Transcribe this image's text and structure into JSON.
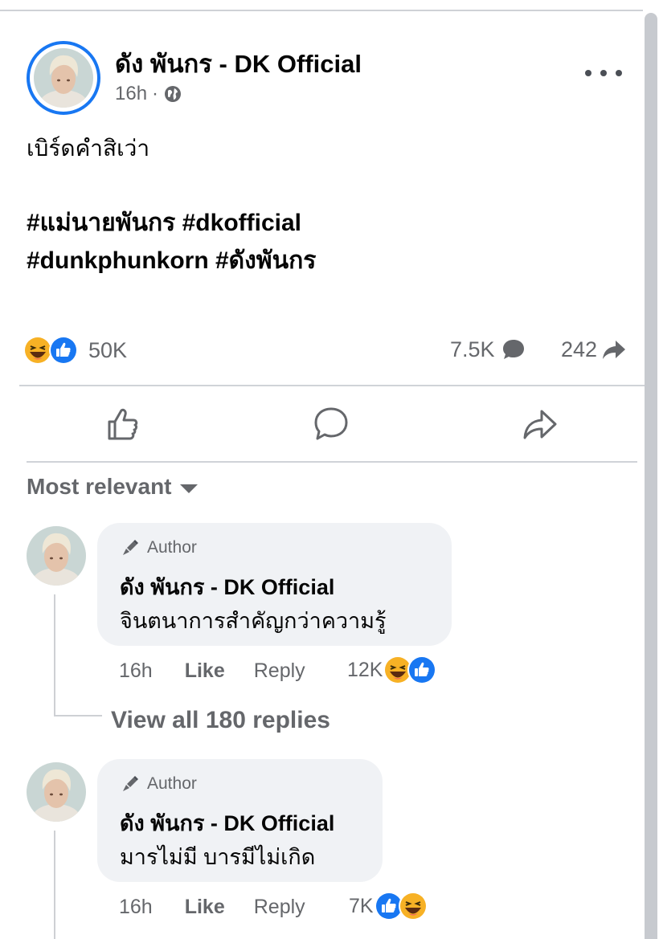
{
  "post": {
    "page_name": "ดัง พันกร - DK Official",
    "time": "16h",
    "separator": "·",
    "privacy_icon": "globe-icon",
    "more_icon": "more-options-icon",
    "text": "เบิร์ดคำสิเว่า",
    "hashtags_line1": "#แม่นายพันกร #dkofficial",
    "hashtags_line2": "#dunkphunkorn #ดังพันกร"
  },
  "stats": {
    "reaction_icons": [
      "haha-icon",
      "like-icon"
    ],
    "reactions_count": "50K",
    "comments_count": "7.5K",
    "shares_count": "242"
  },
  "actions": {
    "like_icon": "thumbs-up-icon",
    "comment_icon": "comment-icon",
    "share_icon": "share-icon"
  },
  "sort": {
    "label": "Most relevant"
  },
  "comments": [
    {
      "badge": "Author",
      "name": "ดัง พันกร - DK Official",
      "text": "จินตนาการสำคัญกว่าความรู้",
      "time": "16h",
      "like_label": "Like",
      "reply_label": "Reply",
      "reaction_count": "12K",
      "reaction_icons": [
        "haha-icon",
        "like-icon"
      ],
      "view_replies": "View all 180 replies"
    },
    {
      "badge": "Author",
      "name": "ดัง พันกร - DK Official",
      "text": "มารไม่มี บารมีไม่เกิด",
      "time": "16h",
      "like_label": "Like",
      "reply_label": "Reply",
      "reaction_count": "7K",
      "reaction_icons": [
        "like-icon",
        "haha-icon"
      ]
    }
  ],
  "colors": {
    "accent": "#1877f2",
    "haha": "#f7b125",
    "secondary_text": "#65676b",
    "bubble": "#f0f2f5"
  }
}
